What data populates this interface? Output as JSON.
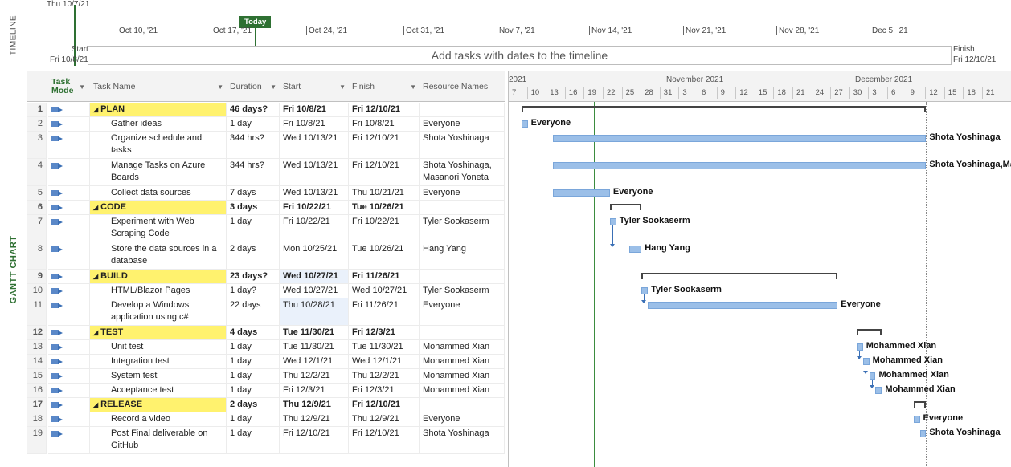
{
  "timeline": {
    "side_label": "TIMELINE",
    "header_date": "Thu 10/7/21",
    "today_label": "Today",
    "ticks": [
      "Oct 10, '21",
      "Oct 17, '21",
      "Oct 24, '21",
      "Oct 31, '21",
      "Nov 7, '21",
      "Nov 14, '21",
      "Nov 21, '21",
      "Nov 28, '21",
      "Dec 5, '21"
    ],
    "placeholder": "Add tasks with dates to the timeline",
    "start_label": "Start",
    "start_date": "Fri 10/8/21",
    "finish_label": "Finish",
    "finish_date": "Fri 12/10/21"
  },
  "gantt": {
    "side_label": "GANTT CHART",
    "columns": {
      "mode": "Task Mode",
      "name": "Task Name",
      "duration": "Duration",
      "start": "Start",
      "finish": "Finish",
      "resources": "Resource Names"
    },
    "tasks": [
      {
        "id": "1",
        "summary": true,
        "name": "PLAN",
        "duration": "46 days?",
        "start": "Fri 10/8/21",
        "finish": "Fri 12/10/21",
        "resources": ""
      },
      {
        "id": "2",
        "summary": false,
        "name": "Gather ideas",
        "duration": "1 day",
        "start": "Fri 10/8/21",
        "finish": "Fri 10/8/21",
        "resources": "Everyone"
      },
      {
        "id": "3",
        "summary": false,
        "name": "Organize schedule and tasks",
        "duration": "344 hrs?",
        "start": "Wed 10/13/21",
        "finish": "Fri 12/10/21",
        "resources": "Shota Yoshinaga"
      },
      {
        "id": "4",
        "summary": false,
        "name": "Manage Tasks on Azure Boards",
        "duration": "344 hrs?",
        "start": "Wed 10/13/21",
        "finish": "Fri 12/10/21",
        "resources": "Shota Yoshinaga, Masanori Yoneta"
      },
      {
        "id": "5",
        "summary": false,
        "name": "Collect data sources",
        "duration": "7 days",
        "start": "Wed 10/13/21",
        "finish": "Thu 10/21/21",
        "resources": "Everyone"
      },
      {
        "id": "6",
        "summary": true,
        "name": "CODE",
        "duration": "3 days",
        "start": "Fri 10/22/21",
        "finish": "Tue 10/26/21",
        "resources": ""
      },
      {
        "id": "7",
        "summary": false,
        "name": "Experiment with Web Scraping Code",
        "duration": "1 day",
        "start": "Fri 10/22/21",
        "finish": "Fri 10/22/21",
        "resources": "Tyler Sookaserm"
      },
      {
        "id": "8",
        "summary": false,
        "name": "Store the data sources in a database",
        "duration": "2 days",
        "start": "Mon 10/25/21",
        "finish": "Tue 10/26/21",
        "resources": "Hang Yang"
      },
      {
        "id": "9",
        "summary": true,
        "name": "BUILD",
        "duration": "23 days?",
        "start": "Wed 10/27/21",
        "finish": "Fri 11/26/21",
        "resources": ""
      },
      {
        "id": "10",
        "summary": false,
        "name": "HTML/Blazor Pages",
        "duration": "1 day?",
        "start": "Wed 10/27/21",
        "finish": "Wed 10/27/21",
        "resources": "Tyler Sookaserm"
      },
      {
        "id": "11",
        "summary": false,
        "name": "Develop a Windows application using c#",
        "duration": "22 days",
        "start": "Thu 10/28/21",
        "finish": "Fri 11/26/21",
        "resources": "Everyone"
      },
      {
        "id": "12",
        "summary": true,
        "name": "TEST",
        "duration": "4 days",
        "start": "Tue 11/30/21",
        "finish": "Fri 12/3/21",
        "resources": ""
      },
      {
        "id": "13",
        "summary": false,
        "name": "Unit test",
        "duration": "1 day",
        "start": "Tue 11/30/21",
        "finish": "Tue 11/30/21",
        "resources": "Mohammed Xian"
      },
      {
        "id": "14",
        "summary": false,
        "name": "Integration test",
        "duration": "1 day",
        "start": "Wed 12/1/21",
        "finish": "Wed 12/1/21",
        "resources": "Mohammed Xian"
      },
      {
        "id": "15",
        "summary": false,
        "name": "System test",
        "duration": "1 day",
        "start": "Thu 12/2/21",
        "finish": "Thu 12/2/21",
        "resources": "Mohammed Xian"
      },
      {
        "id": "16",
        "summary": false,
        "name": "Acceptance test",
        "duration": "1 day",
        "start": "Fri 12/3/21",
        "finish": "Fri 12/3/21",
        "resources": "Mohammed Xian"
      },
      {
        "id": "17",
        "summary": true,
        "name": "RELEASE",
        "duration": "2 days",
        "start": "Thu 12/9/21",
        "finish": "Fri 12/10/21",
        "resources": ""
      },
      {
        "id": "18",
        "summary": false,
        "name": "Record a video",
        "duration": "1 day",
        "start": "Thu 12/9/21",
        "finish": "Thu 12/9/21",
        "resources": "Everyone"
      },
      {
        "id": "19",
        "summary": false,
        "name": "Post Final deliverable on GitHub",
        "duration": "1 day",
        "start": "Fri 12/10/21",
        "finish": "Fri 12/10/21",
        "resources": "Shota Yoshinaga"
      }
    ],
    "chart_header": {
      "months": [
        "2021",
        "November 2021",
        "December 2021"
      ],
      "days": [
        "7",
        "10",
        "13",
        "16",
        "19",
        "22",
        "25",
        "28",
        "31",
        "3",
        "6",
        "9",
        "12",
        "15",
        "18",
        "21",
        "24",
        "27",
        "30",
        "3",
        "6",
        "9",
        "12",
        "15",
        "18",
        "21"
      ]
    },
    "bar_labels": {
      "2": "Everyone",
      "3": "Shota Yoshinaga",
      "4": "Shota Yoshinaga,Ma",
      "5": "Everyone",
      "7": "Tyler Sookaserm",
      "8": "Hang Yang",
      "10": "Tyler Sookaserm",
      "11": "Everyone",
      "13": "Mohammed Xian",
      "14": "Mohammed Xian",
      "15": "Mohammed Xian",
      "16": "Mohammed Xian",
      "18": "Everyone",
      "19": "Shota Yoshinaga"
    }
  },
  "colors": {
    "summary_highlight": "#fff26e",
    "today_green": "#2e7032",
    "bar_blue": "#9bbfe8"
  }
}
